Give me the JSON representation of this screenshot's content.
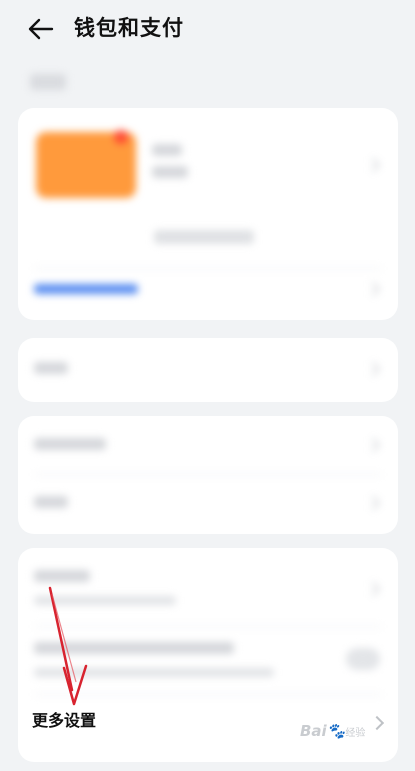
{
  "header": {
    "title": "钱包和支付",
    "back_icon": "back-arrow-icon"
  },
  "settings": {
    "more_label": "更多设置"
  },
  "watermark": {
    "text": "Bai",
    "sub": "经验"
  },
  "colors": {
    "annotation_arrow": "#d8232f",
    "card_orange": "#ff9a3c",
    "link_blue": "#5b8ff1"
  }
}
